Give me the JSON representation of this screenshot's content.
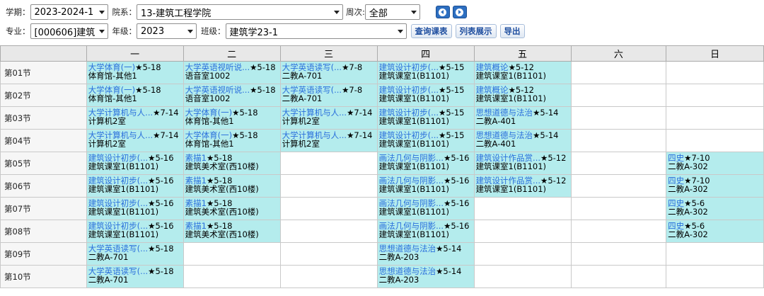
{
  "filters": {
    "semester_label": "学期：",
    "semester_value": "2023-2024-1",
    "dept_label": "院系：",
    "dept_value": "13-建筑工程学院",
    "week_label": "周次:",
    "week_value": "全部",
    "major_label": "专业：",
    "major_value": "[000606]建筑学",
    "grade_label": "年级：",
    "grade_value": "2023",
    "class_label": "班级：",
    "class_value": "建筑学23-1",
    "query_button": "查询课表",
    "list_button": "列表展示",
    "export_button": "导出"
  },
  "timetable": {
    "days": [
      "一",
      "二",
      "三",
      "四",
      "五",
      "六",
      "日"
    ],
    "periods": [
      "第01节",
      "第02节",
      "第03节",
      "第04节",
      "第05节",
      "第06节",
      "第07节",
      "第08节",
      "第09节",
      "第10节"
    ],
    "grid": [
      [
        {
          "name": "大学体育(一)",
          "weeks": "★5-18",
          "room": "体育馆-其他1"
        },
        {
          "name": "大学英语视听说...",
          "weeks": "★5-18",
          "room": "语音室1002"
        },
        {
          "name": "大学英语读写(...",
          "weeks": "★7-8",
          "room": "二教A-701"
        },
        {
          "name": "建筑设计初步(...",
          "weeks": "★5-15",
          "room": "建筑课室1(B1101)"
        },
        {
          "name": "建筑概论",
          "weeks": "★5-12",
          "room": "建筑课室1(B1101)"
        },
        null,
        null
      ],
      [
        {
          "name": "大学体育(一)",
          "weeks": "★5-18",
          "room": "体育馆-其他1"
        },
        {
          "name": "大学英语视听说...",
          "weeks": "★5-18",
          "room": "语音室1002"
        },
        {
          "name": "大学英语读写(...",
          "weeks": "★7-8",
          "room": "二教A-701"
        },
        {
          "name": "建筑设计初步(...",
          "weeks": "★5-15",
          "room": "建筑课室1(B1101)"
        },
        {
          "name": "建筑概论",
          "weeks": "★5-12",
          "room": "建筑课室1(B1101)"
        },
        null,
        null
      ],
      [
        {
          "name": "大学计算机与人...",
          "weeks": "★7-14",
          "room": "计算机2室"
        },
        {
          "name": "大学体育(一)",
          "weeks": "★5-18",
          "room": "体育馆-其他1"
        },
        {
          "name": "大学计算机与人...",
          "weeks": "★7-14",
          "room": "计算机2室"
        },
        {
          "name": "建筑设计初步(...",
          "weeks": "★5-15",
          "room": "建筑课室1(B1101)"
        },
        {
          "name": "思想道德与法治",
          "weeks": "★5-14",
          "room": "二教A-401"
        },
        null,
        null
      ],
      [
        {
          "name": "大学计算机与人...",
          "weeks": "★7-14",
          "room": "计算机2室"
        },
        {
          "name": "大学体育(一)",
          "weeks": "★5-18",
          "room": "体育馆-其他1"
        },
        {
          "name": "大学计算机与人...",
          "weeks": "★7-14",
          "room": "计算机2室"
        },
        {
          "name": "建筑设计初步(...",
          "weeks": "★5-15",
          "room": "建筑课室1(B1101)"
        },
        {
          "name": "思想道德与法治",
          "weeks": "★5-14",
          "room": "二教A-401"
        },
        null,
        null
      ],
      [
        {
          "name": "建筑设计初步(...",
          "weeks": "★5-16",
          "room": "建筑课室1(B1101)"
        },
        {
          "name": "素描1",
          "weeks": "★5-18",
          "room": "建筑美术室(西10楼)"
        },
        null,
        {
          "name": "画法几何与阴影...",
          "weeks": "★5-16",
          "room": "建筑课室1(B1101)"
        },
        {
          "name": "建筑设计作品赏...",
          "weeks": "★5-12",
          "room": "建筑课室1(B1101)"
        },
        null,
        {
          "name": "四史",
          "weeks": "★7-10",
          "room": "二教A-302"
        }
      ],
      [
        {
          "name": "建筑设计初步(...",
          "weeks": "★5-16",
          "room": "建筑课室1(B1101)"
        },
        {
          "name": "素描1",
          "weeks": "★5-18",
          "room": "建筑美术室(西10楼)"
        },
        null,
        {
          "name": "画法几何与阴影...",
          "weeks": "★5-16",
          "room": "建筑课室1(B1101)"
        },
        {
          "name": "建筑设计作品赏...",
          "weeks": "★5-12",
          "room": "建筑课室1(B1101)"
        },
        null,
        {
          "name": "四史",
          "weeks": "★7-10",
          "room": "二教A-302"
        }
      ],
      [
        {
          "name": "建筑设计初步(...",
          "weeks": "★5-16",
          "room": "建筑课室1(B1101)"
        },
        {
          "name": "素描1",
          "weeks": "★5-18",
          "room": "建筑美术室(西10楼)"
        },
        null,
        {
          "name": "画法几何与阴影...",
          "weeks": "★5-16",
          "room": "建筑课室1(B1101)"
        },
        null,
        null,
        {
          "name": "四史",
          "weeks": "★5-6",
          "room": "二教A-302"
        }
      ],
      [
        {
          "name": "建筑设计初步(...",
          "weeks": "★5-16",
          "room": "建筑课室1(B1101)"
        },
        {
          "name": "素描1",
          "weeks": "★5-18",
          "room": "建筑美术室(西10楼)"
        },
        null,
        {
          "name": "画法几何与阴影...",
          "weeks": "★5-16",
          "room": "建筑课室1(B1101)"
        },
        null,
        null,
        {
          "name": "四史",
          "weeks": "★5-6",
          "room": "二教A-302"
        }
      ],
      [
        {
          "name": "大学英语读写(...",
          "weeks": "★5-18",
          "room": "二教A-701"
        },
        null,
        null,
        {
          "name": "思想道德与法治",
          "weeks": "★5-14",
          "room": "二教A-203"
        },
        null,
        null,
        null
      ],
      [
        {
          "name": "大学英语读写(...",
          "weeks": "★5-18",
          "room": "二教A-701"
        },
        null,
        null,
        {
          "name": "思想道德与法治",
          "weeks": "★5-14",
          "room": "二教A-203"
        },
        null,
        null,
        null
      ]
    ]
  }
}
